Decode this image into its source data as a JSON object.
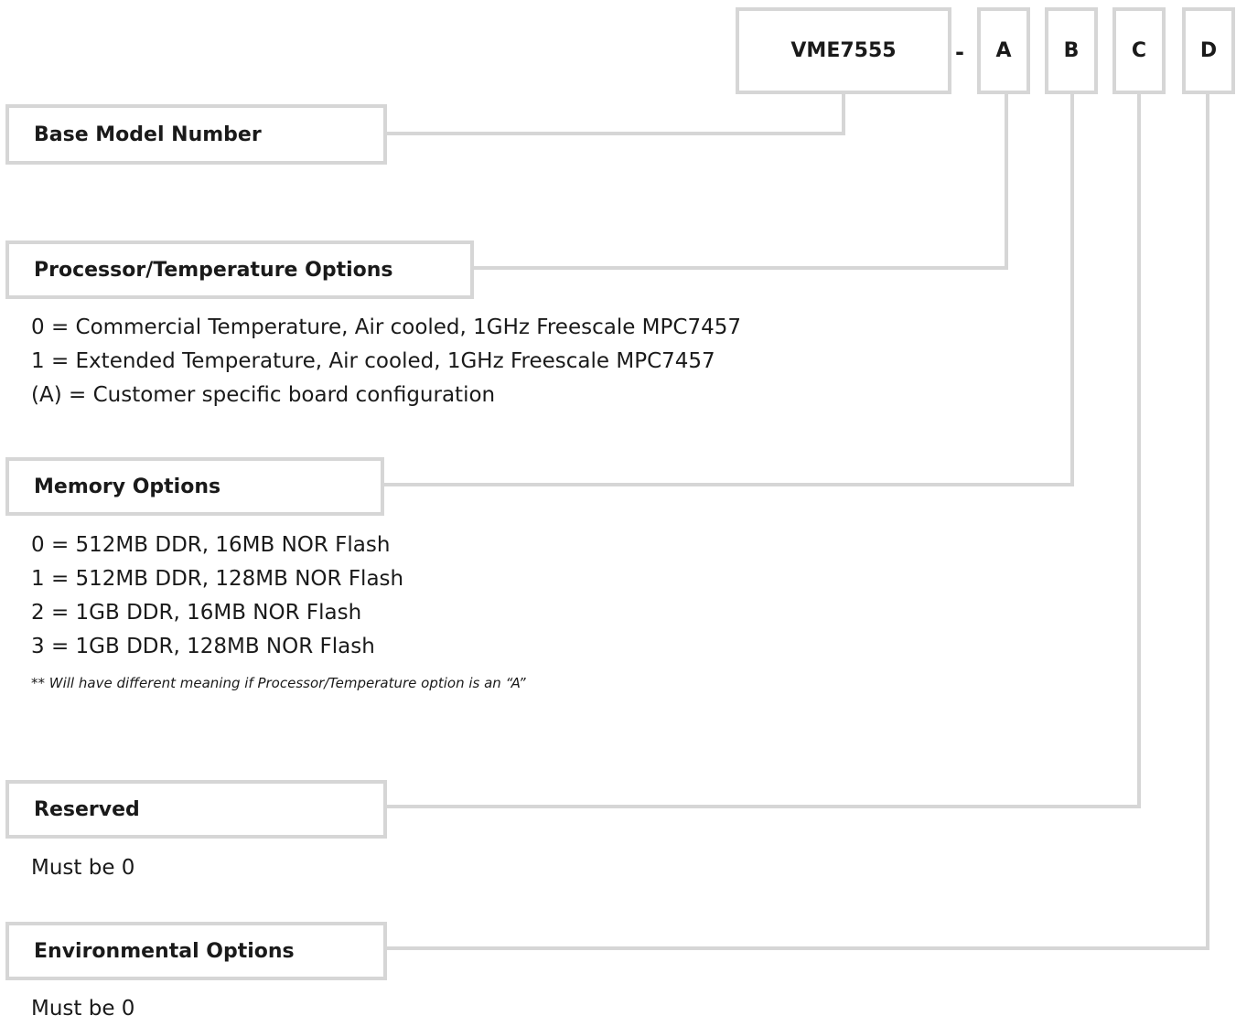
{
  "part_number": {
    "base": "VME7555",
    "separator": "-",
    "positions": [
      "A",
      "B",
      "C",
      "D"
    ]
  },
  "sections": {
    "base_model": {
      "title": "Base Model Number"
    },
    "processor": {
      "title": "Processor/Temperature Options",
      "options": [
        "0 = Commercial Temperature, Air cooled, 1GHz Freescale MPC7457",
        "1 = Extended Temperature, Air cooled, 1GHz Freescale MPC7457",
        "(A) = Customer specific board configuration"
      ]
    },
    "memory": {
      "title": "Memory Options",
      "options": [
        "0 = 512MB DDR, 16MB NOR Flash",
        "1 = 512MB DDR, 128MB NOR Flash",
        "2 = 1GB DDR, 16MB NOR Flash",
        "3 = 1GB DDR, 128MB NOR Flash"
      ],
      "note": "** Will have different meaning if Processor/Temperature option is an “A”"
    },
    "reserved": {
      "title": "Reserved",
      "text": "Must be 0"
    },
    "environmental": {
      "title": "Environmental Options",
      "text": "Must be 0"
    }
  },
  "colors": {
    "border": "#d6d6d6",
    "text": "#1a1a1a",
    "background": "#ffffff"
  }
}
